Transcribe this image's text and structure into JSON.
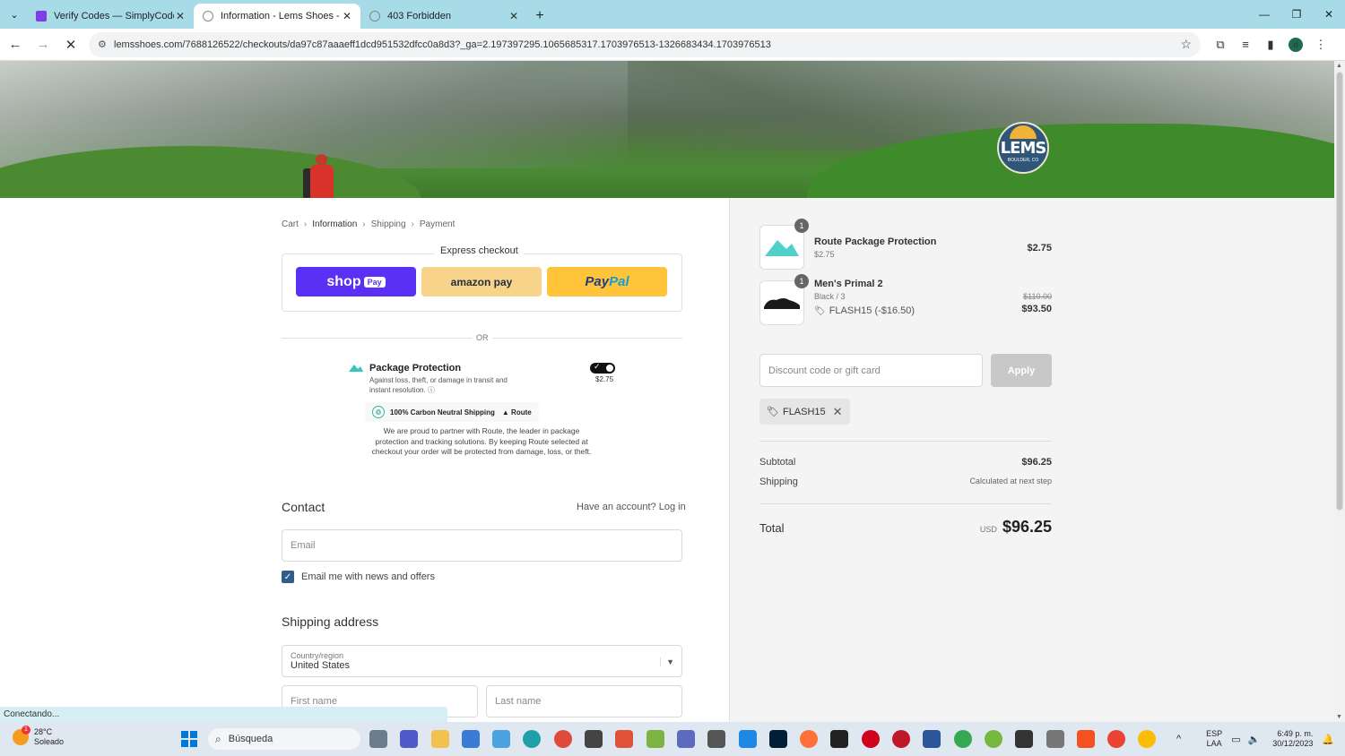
{
  "browser": {
    "tabs": [
      {
        "title": "Verify Codes — SimplyCodes",
        "active": false,
        "favicon_color": "#7b3fe4"
      },
      {
        "title": "Information - Lems Shoes - Che",
        "active": true,
        "favicon_color": "#888888"
      },
      {
        "title": "403 Forbidden",
        "active": false,
        "favicon_color": "#888888"
      }
    ],
    "url": "lemsshoes.com/7688126522/checkouts/da97c87aaaeff1dcd951532dfcc0a8d3?_ga=2.197397295.1065685317.1703976513-1326683434.1703976513",
    "profile_initial": "d",
    "status_text": "Conectando..."
  },
  "hero": {
    "logo_text": "LEMS",
    "logo_subtext": "BOULDER, CO"
  },
  "breadcrumb": {
    "items": [
      "Cart",
      "Information",
      "Shipping",
      "Payment"
    ],
    "current": "Information"
  },
  "express": {
    "title": "Express checkout",
    "shop_label": "shop",
    "shop_pay_badge": "Pay",
    "amazon_label": "amazon pay",
    "paypal_part1": "Pay",
    "paypal_part2": "Pal",
    "or": "OR"
  },
  "package_protection": {
    "title": "Package Protection",
    "desc": "Against loss, theft, or damage in transit and instant resolution.",
    "price": "$2.75",
    "enabled": true,
    "carbon_text": "100% Carbon Neutral Shipping",
    "route_label": "Route",
    "partner_text": "We are proud to partner with Route, the leader in package protection and tracking solutions. By keeping Route selected at checkout your order will be protected from damage, loss, or theft."
  },
  "contact": {
    "heading": "Contact",
    "have_account": "Have an account?",
    "login": "Log in",
    "email_placeholder": "Email",
    "newsletter_label": "Email me with news and offers",
    "newsletter_checked": true
  },
  "shipping": {
    "heading": "Shipping address",
    "country_label": "Country/region",
    "country_value": "United States",
    "first_name_placeholder": "First name",
    "last_name_placeholder": "Last name"
  },
  "order": {
    "items": [
      {
        "name": "Route Package Protection",
        "sub": "$2.75",
        "qty": "1",
        "price": "$2.75"
      },
      {
        "name": "Men's Primal 2",
        "sub": "Black / 3",
        "qty": "1",
        "original_price": "$110.00",
        "price": "$93.50",
        "discount": "FLASH15 (-$16.50)"
      }
    ],
    "discount_placeholder": "Discount code or gift card",
    "apply_label": "Apply",
    "applied_code": "FLASH15",
    "subtotal_label": "Subtotal",
    "subtotal_value": "$96.25",
    "shipping_label": "Shipping",
    "shipping_value": "Calculated at next step",
    "total_label": "Total",
    "currency": "USD",
    "total_value": "$96.25"
  },
  "taskbar": {
    "temp": "28°C",
    "weather": "Soleado",
    "weather_badge": "1",
    "search_label": "Búsqueda",
    "lang_line1": "ESP",
    "lang_line2": "LAA",
    "time": "6:49 p. m.",
    "date": "30/12/2023"
  }
}
